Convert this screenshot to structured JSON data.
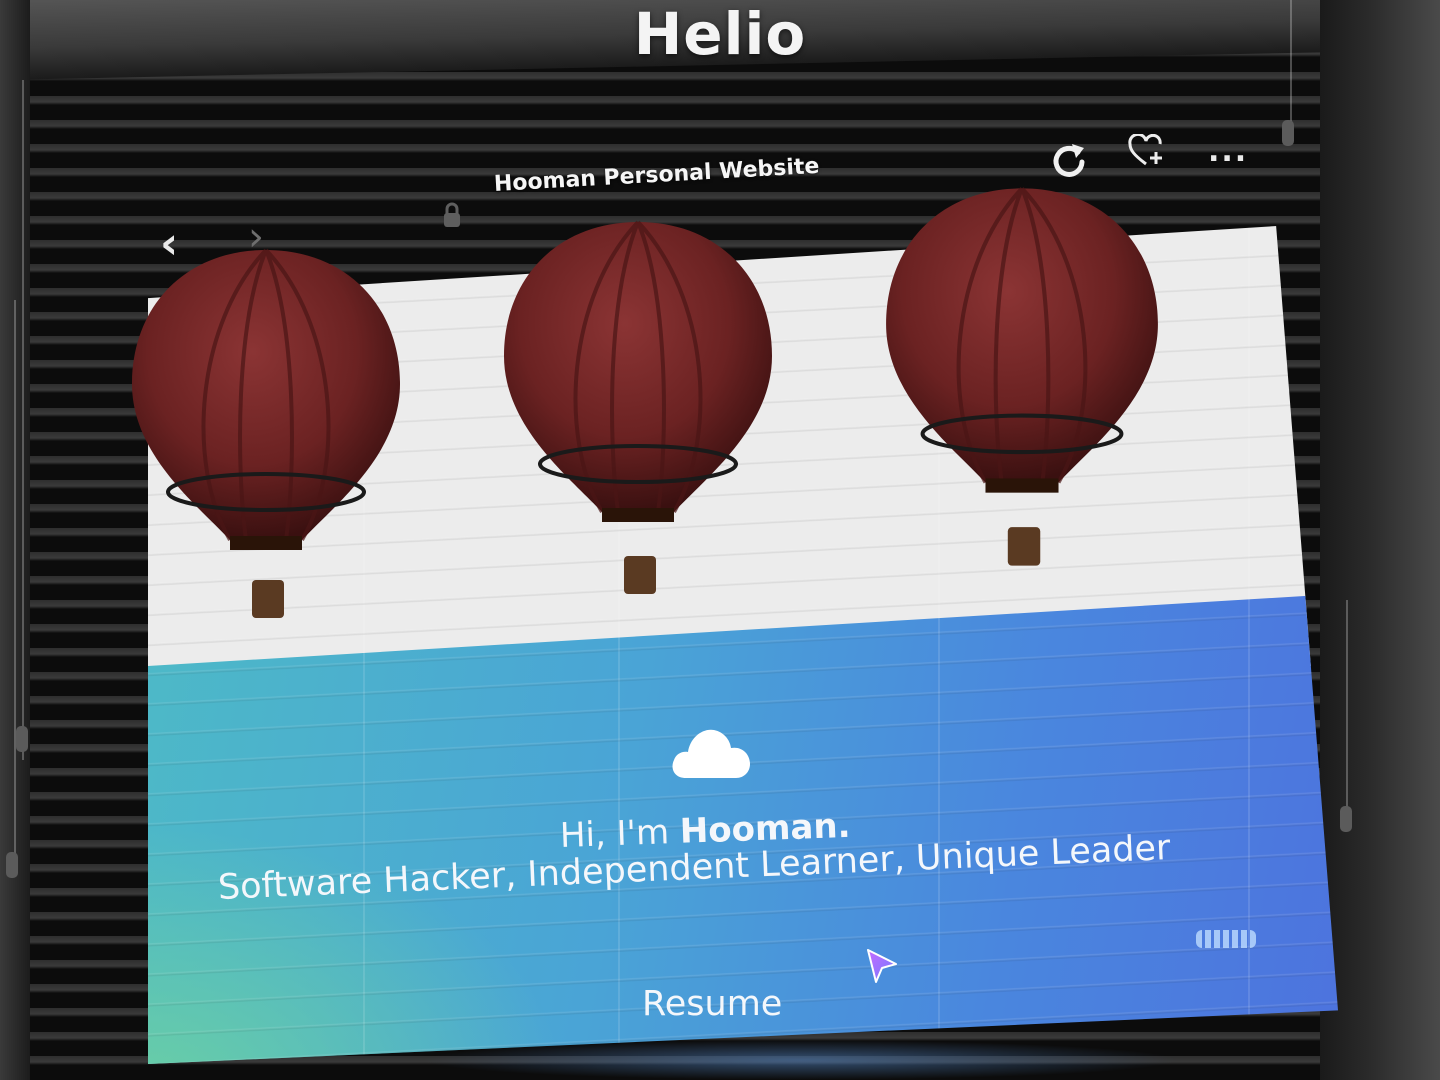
{
  "app": {
    "title": "Helio"
  },
  "browser": {
    "tab_title": "Hooman Personal Website",
    "back_icon": "chevron-left-icon",
    "forward_icon": "chevron-right-icon",
    "lock_icon": "lock-icon",
    "reload_icon": "reload-icon",
    "favorite_icon": "heart-plus-icon",
    "more_icon": "more-icon",
    "more_label": "..."
  },
  "page": {
    "balloon_colors": {
      "envelope": "#6b2222",
      "basket": "#5a3a22"
    },
    "hero": {
      "cloud_icon": "cloud-icon",
      "greeting_prefix": "Hi, I'm ",
      "greeting_name": "Hooman.",
      "tagline": "Software Hacker, Independent Learner, Unique Leader",
      "resume_label": "Resume"
    },
    "gradient": {
      "start": "#4db9c7",
      "end": "#4d73de"
    }
  }
}
